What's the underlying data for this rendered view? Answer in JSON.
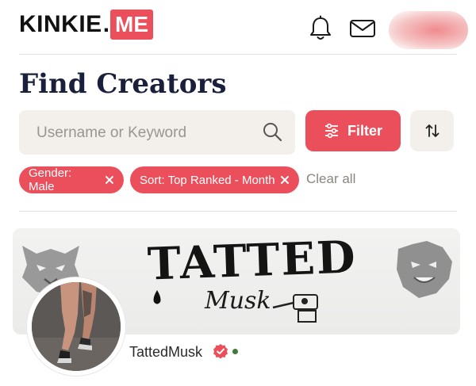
{
  "header": {
    "logo_text": "KINKIE",
    "logo_dot": ".",
    "logo_badge": "ME",
    "icons": [
      "bell-icon",
      "mail-icon",
      "user-avatar"
    ]
  },
  "page_title": "Find Creators",
  "search": {
    "placeholder": "Username or Keyword",
    "value": ""
  },
  "filter_button": {
    "label": "Filter"
  },
  "sort_button": {
    "icon": "sort-arrows-icon"
  },
  "active_filters": [
    {
      "label": "Gender: Male"
    },
    {
      "label": "Sort: Top Ranked - Month"
    }
  ],
  "clear_all_label": "Clear all",
  "creators": [
    {
      "banner_title": "TATTED",
      "banner_script": "Musk",
      "name": "TattedMusk",
      "verified": true,
      "online": true
    }
  ],
  "colors": {
    "accent": "#ec4f5c",
    "title": "#1a1f3c",
    "surface": "#f3efea",
    "online": "#3f7a3a"
  }
}
